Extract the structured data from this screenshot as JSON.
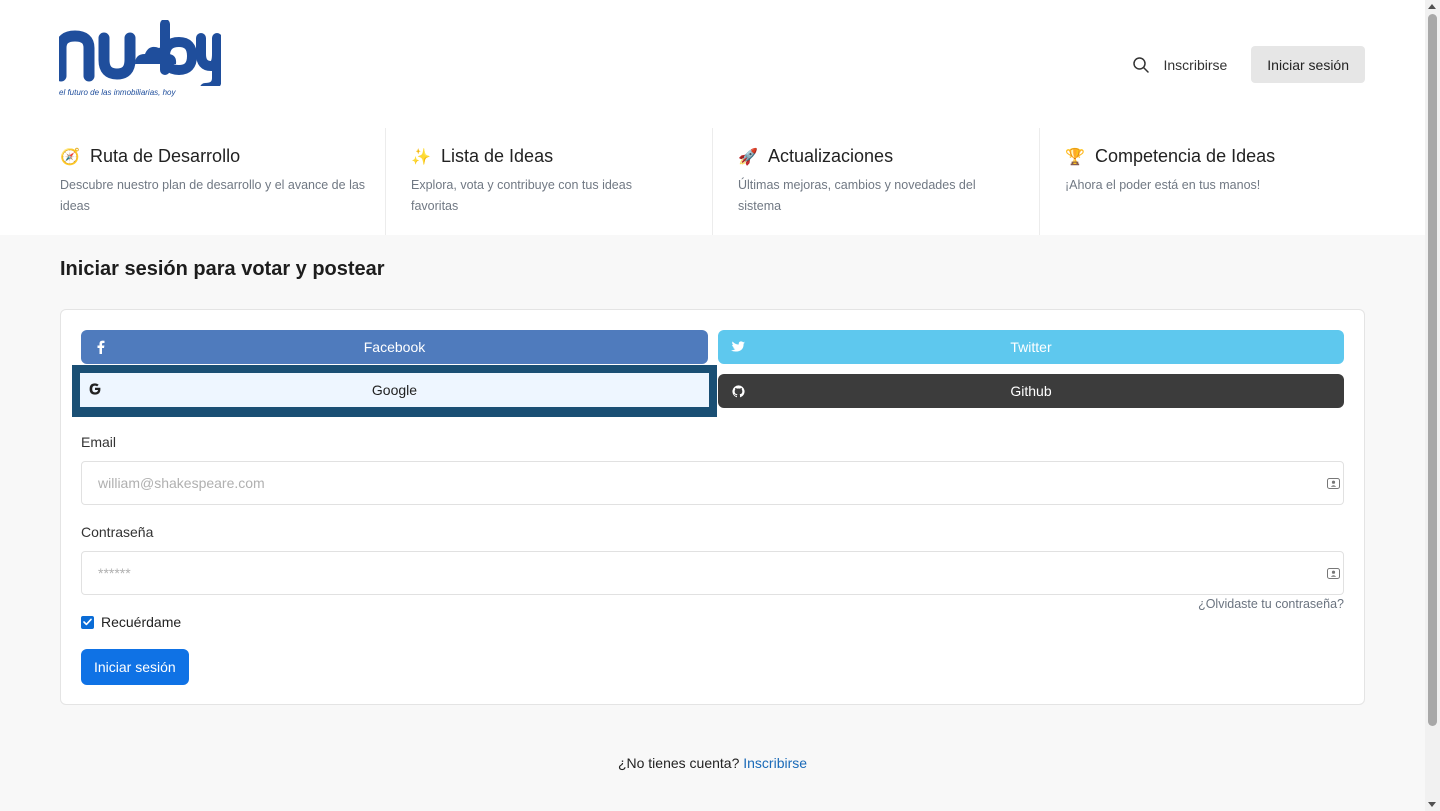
{
  "brand": {
    "tagline": "el futuro de las inmobiliarias, hoy",
    "logo_alt": "nuby",
    "color": "#1f4e9c"
  },
  "nav": {
    "signup_label": "Inscribirse",
    "login_label": "Iniciar sesión"
  },
  "features": [
    {
      "icon": "compass-icon",
      "emoji": "🧭",
      "title": "Ruta de Desarrollo",
      "desc": "Descubre nuestro plan de desarrollo y el avance de las ideas"
    },
    {
      "icon": "sparkles-icon",
      "emoji": "✨",
      "title": "Lista de Ideas",
      "desc": "Explora, vota y contribuye con tus ideas favoritas"
    },
    {
      "icon": "rocket-icon",
      "emoji": "🚀",
      "title": "Actualizaciones",
      "desc": "Últimas mejoras, cambios y novedades del sistema"
    },
    {
      "icon": "trophy-icon",
      "emoji": "🏆",
      "title": "Competencia de Ideas",
      "desc": "¡Ahora el poder está en tus manos!"
    }
  ],
  "page": {
    "heading": "Iniciar sesión para votar y postear"
  },
  "social": {
    "facebook": "Facebook",
    "twitter": "Twitter",
    "google": "Google",
    "github": "Github"
  },
  "form": {
    "email_label": "Email",
    "email_placeholder": "william@shakespeare.com",
    "password_label": "Contraseña",
    "password_placeholder": "******",
    "forgot": "¿Olvidaste tu contraseña?",
    "remember": "Recuérdame",
    "remember_checked": true,
    "submit": "Iniciar sesión"
  },
  "footer": {
    "question": "¿No tienes cuenta?",
    "signup_link": "Inscribirse"
  },
  "colors": {
    "facebook": "#4f7bbd",
    "twitter": "#5ec8ee",
    "github": "#3c3c3c",
    "google_focus": "#1a4f74",
    "primary": "#0f72e5"
  }
}
